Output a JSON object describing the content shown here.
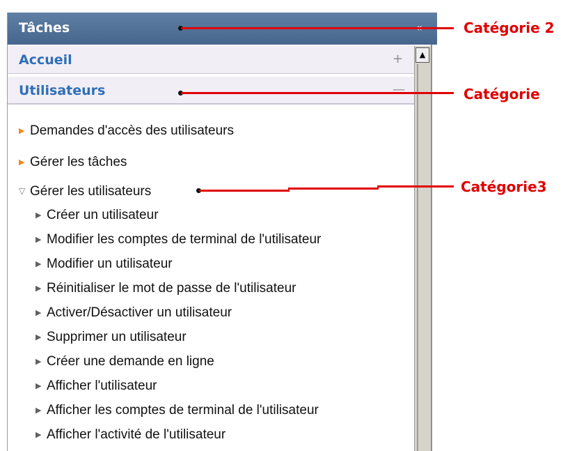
{
  "panel": {
    "title": "Tâches",
    "collapse_icon": "double-chevron-left-icon",
    "sections": [
      {
        "label": "Accueil",
        "toggle": "plus-icon",
        "toggle_glyph": "+"
      },
      {
        "label": "Utilisateurs",
        "toggle": "minus-icon",
        "toggle_glyph": "—"
      }
    ],
    "items": [
      {
        "label": "Demandes d'accès des utilisateurs",
        "icon": "triangle-right-orange-icon"
      },
      {
        "label": "Gérer les tâches",
        "icon": "triangle-right-orange-icon"
      },
      {
        "label": "Gérer les utilisateurs",
        "icon": "triangle-down-outline-icon"
      }
    ],
    "subitems": [
      "Créer un utilisateur",
      "Modifier les comptes de terminal de l'utilisateur",
      "Modifier un utilisateur",
      "Réinitialiser le mot de passe de l'utilisateur",
      "Activer/Désactiver un utilisateur",
      "Supprimer un utilisateur",
      "Créer une demande en ligne",
      "Afficher l'utilisateur",
      "Afficher les comptes de terminal de l'utilisateur",
      "Afficher l'activité de l'utilisateur"
    ]
  },
  "annotations": {
    "cat2": "Catégorie 2",
    "cat": "Catégorie",
    "cat3": "Catégorie3"
  },
  "colors": {
    "header": "#52739b",
    "link_blue": "#2e6fb7",
    "annotation_red": "#e00000",
    "arrow_orange": "#f08a1c"
  }
}
